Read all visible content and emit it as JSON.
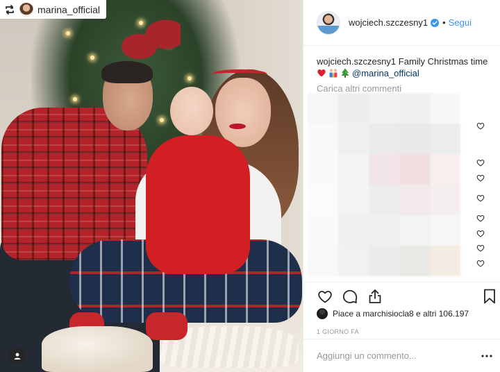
{
  "photo": {
    "repost_badge": {
      "username": "marina_official",
      "icon": "repost-icon"
    },
    "tag_icon": "user-tag-icon"
  },
  "header": {
    "username": "wojciech.szczesny1",
    "verified_icon": "verified-badge-icon",
    "separator": "•",
    "follow_label": "Segui",
    "follow_color": "#3897f0"
  },
  "caption": {
    "username": "wojciech.szczesny1",
    "text": "Family Christmas time",
    "emojis": [
      "red-heart-emoji",
      "family-emoji",
      "christmas-tree-emoji"
    ],
    "mention": "@marina_official"
  },
  "comments": {
    "load_more_label": "Carica altri commenti",
    "hidden_comment_hearts": 8
  },
  "actions": {
    "like_icon": "heart-icon",
    "comment_icon": "comment-icon",
    "share_icon": "share-icon",
    "save_icon": "bookmark-icon"
  },
  "likes": {
    "text": "Piace a marchisiocla8 e altri 106.197"
  },
  "timestamp": "1 GIORNO FA",
  "add_comment": {
    "placeholder": "Aggiungi un commento...",
    "options_icon": "more-options-icon"
  },
  "colors": {
    "text": "#262626",
    "muted": "#999999",
    "link": "#3897f0",
    "mention": "#003569",
    "border": "#efefef"
  }
}
